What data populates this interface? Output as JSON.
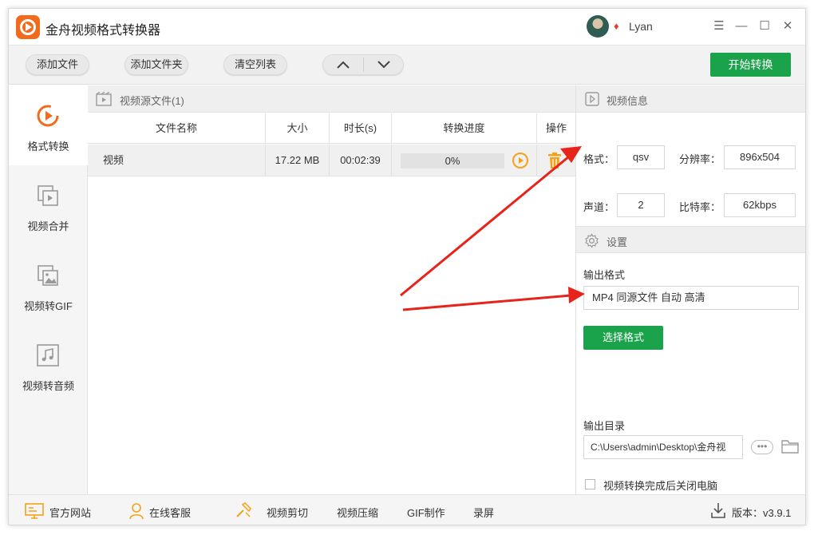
{
  "app": {
    "title": "金舟视频格式转换器",
    "user_name": "Lyan"
  },
  "window_controls": {
    "menu": "☰",
    "minimize": "—",
    "maximize": "☐",
    "close": "✕"
  },
  "toolbar": {
    "add_file": "添加文件",
    "add_folder": "添加文件夹",
    "clear_list": "清空列表",
    "move_up": "︿",
    "move_down": "﹀",
    "start_convert": "开始转换"
  },
  "sidebar": {
    "items": [
      {
        "label": "格式转换",
        "icon": "convert-icon",
        "active": true
      },
      {
        "label": "视频合并",
        "icon": "merge-icon",
        "active": false
      },
      {
        "label": "视频转GIF",
        "icon": "gif-icon",
        "active": false
      },
      {
        "label": "视频转音频",
        "icon": "audio-icon",
        "active": false
      }
    ]
  },
  "file_panel": {
    "title": "视频源文件(1)",
    "columns": [
      "文件名称",
      "大小",
      "时长(s)",
      "转换进度",
      "操作"
    ],
    "rows": [
      {
        "name": "视频",
        "size": "17.22 MB",
        "duration": "00:02:39",
        "progress_text": "0%",
        "progress": 0
      }
    ]
  },
  "video_info": {
    "title": "视频信息",
    "format_label": "格式：",
    "format_value": "qsv",
    "resolution_label": "分辨率：",
    "resolution_value": "896x504",
    "channels_label": "声道：",
    "channels_value": "2",
    "bitrate_label": "比特率：",
    "bitrate_value": "62kbps"
  },
  "settings": {
    "title": "设置",
    "output_format_label": "输出格式",
    "output_format_value": "MP4 同源文件 自动 高清",
    "choose_format": "选择格式",
    "output_dir_label": "输出目录",
    "output_dir_value": "C:\\Users\\admin\\Desktop\\金舟视",
    "more": "•••",
    "shutdown_label": "视频转换完成后关闭电脑"
  },
  "statusbar": {
    "website": "官方网站",
    "support": "在线客服",
    "video_cut": "视频剪切",
    "video_compress": "视频压缩",
    "gif_make": "GIF制作",
    "record": "录屏",
    "version": "版本：v3.9.1"
  },
  "colors": {
    "accent_green": "#1aa34a",
    "accent_orange": "#f26b1d",
    "arrow_red": "#e8231b"
  }
}
